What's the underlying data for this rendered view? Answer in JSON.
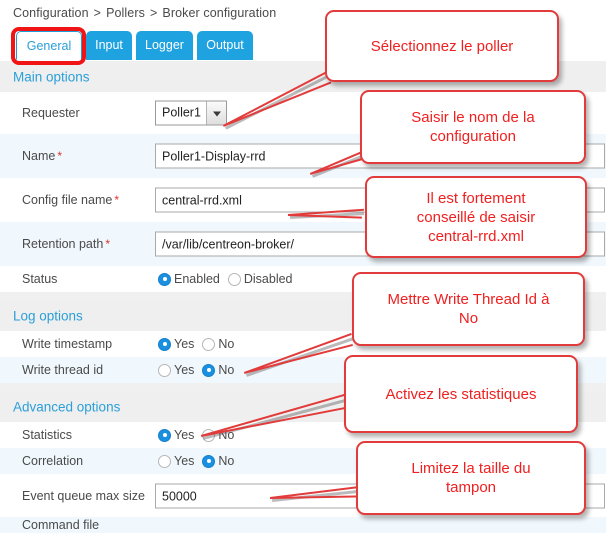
{
  "breadcrumb": {
    "items": [
      "Configuration",
      "Pollers",
      "Broker configuration"
    ],
    "separator": ">"
  },
  "tabs": [
    {
      "label": "General",
      "active": true
    },
    {
      "label": "Input",
      "active": false
    },
    {
      "label": "Logger",
      "active": false
    },
    {
      "label": "Output",
      "active": false
    }
  ],
  "sections": {
    "main": {
      "title": "Main options"
    },
    "log": {
      "title": "Log options"
    },
    "advanced": {
      "title": "Advanced options"
    }
  },
  "fields": {
    "requester": {
      "label": "Requester",
      "value": "Poller1"
    },
    "name": {
      "label": "Name",
      "required_marker": "*",
      "value": "Poller1-Display-rrd"
    },
    "config_file_name": {
      "label": "Config file name",
      "required_marker": "*",
      "value": "central-rrd.xml"
    },
    "retention_path": {
      "label": "Retention path",
      "required_marker": "*",
      "value": "/var/lib/centreon-broker/"
    },
    "status": {
      "label": "Status",
      "options": [
        "Enabled",
        "Disabled"
      ],
      "selected": "Enabled"
    },
    "write_timestamp": {
      "label": "Write timestamp",
      "options": [
        "Yes",
        "No"
      ],
      "selected": "Yes"
    },
    "write_thread_id": {
      "label": "Write thread id",
      "options": [
        "Yes",
        "No"
      ],
      "selected": "No"
    },
    "statistics": {
      "label": "Statistics",
      "options": [
        "Yes",
        "No"
      ],
      "selected": "Yes"
    },
    "correlation": {
      "label": "Correlation",
      "options": [
        "Yes",
        "No"
      ],
      "selected": "No"
    },
    "event_queue_max_size": {
      "label": "Event queue max size",
      "value": "50000"
    },
    "command_file": {
      "label": "Command file"
    }
  },
  "annotations": [
    {
      "id": "select-poller",
      "text": "Sélectionnez le poller"
    },
    {
      "id": "config-name",
      "line1": "Saisir le nom de la",
      "line2": "configuration"
    },
    {
      "id": "central-rrd",
      "line1": "Il est fortement",
      "line2": "conseillé de saisir",
      "line3": "central-rrd.xml"
    },
    {
      "id": "write-thread-id",
      "line1": "Mettre Write Thread Id à",
      "line2": "No"
    },
    {
      "id": "statistics",
      "text": "Activez les statistiques"
    },
    {
      "id": "queue-size",
      "line1": "Limitez la taille du",
      "line2": "tampon"
    }
  ],
  "colors": {
    "tab_active_bg": "#ffffff",
    "tab_inactive_bg": "#1fa2e0",
    "tab_active_text": "#2b9fd9",
    "section_text": "#2b9fd9",
    "annotation_red": "#f02020",
    "highlight_red": "#f01414",
    "radio_selected": "#1b8fe0",
    "row_alt_bg": "#f0f8fd"
  },
  "icons": {
    "dropdown_arrow": "chevron-down-icon",
    "required_asterisk": "required-asterisk-icon"
  }
}
